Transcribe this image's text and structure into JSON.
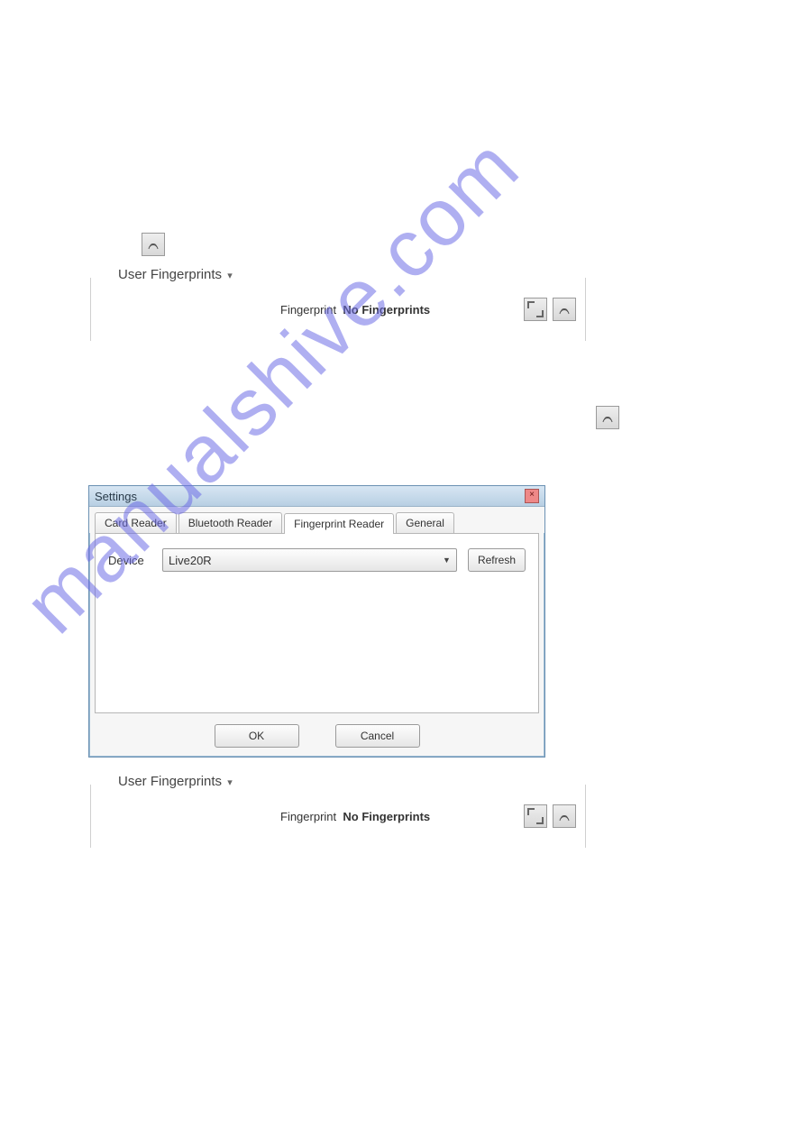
{
  "watermark": "manualshive.com",
  "panel1": {
    "title": "User Fingerprints",
    "label": "Fingerprint",
    "value": "No Fingerprints"
  },
  "panel2": {
    "title": "User Fingerprints",
    "label": "Fingerprint",
    "value": "No Fingerprints"
  },
  "dialog": {
    "title": "Settings",
    "tabs": {
      "card": "Card Reader",
      "bluetooth": "Bluetooth Reader",
      "fingerprint": "Fingerprint Reader",
      "general": "General"
    },
    "device_label": "Device",
    "device_value": "Live20R",
    "refresh": "Refresh",
    "ok": "OK",
    "cancel": "Cancel"
  }
}
